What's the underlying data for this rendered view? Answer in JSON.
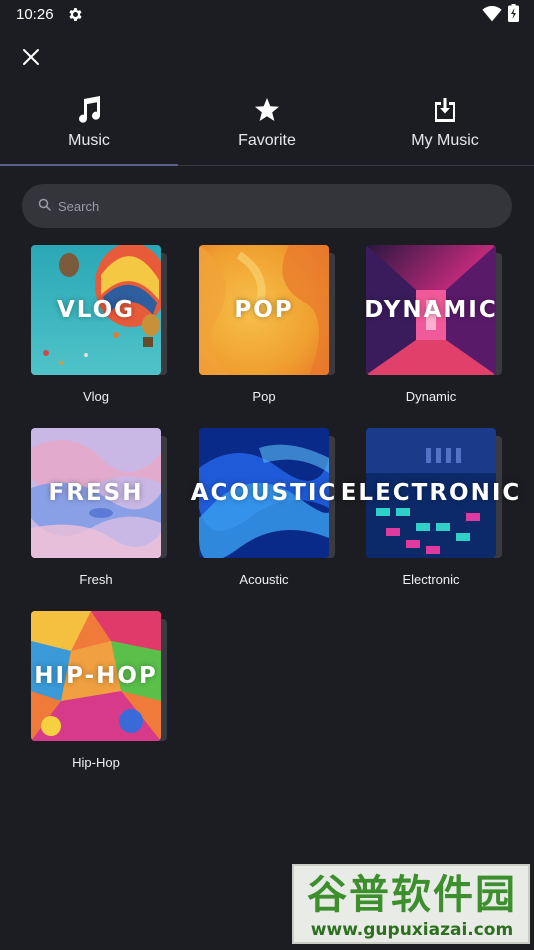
{
  "status_bar": {
    "time": "10:26",
    "icons": [
      "gear-icon",
      "wifi-icon",
      "battery-icon"
    ]
  },
  "header": {
    "close_icon": "close-icon"
  },
  "tabs": [
    {
      "label": "Music",
      "icon": "music-note-icon",
      "selected": true
    },
    {
      "label": "Favorite",
      "icon": "star-icon",
      "selected": false
    },
    {
      "label": "My Music",
      "icon": "download-icon",
      "selected": false
    }
  ],
  "search": {
    "placeholder": "Search",
    "value": ""
  },
  "genres": [
    {
      "title": "VLOG",
      "label": "Vlog"
    },
    {
      "title": "POP",
      "label": "Pop"
    },
    {
      "title": "DYNAMIC",
      "label": "Dynamic"
    },
    {
      "title": "FRESH",
      "label": "Fresh"
    },
    {
      "title": "ACOUSTIC",
      "label": "Acoustic"
    },
    {
      "title": "ELECTRONIC",
      "label": "Electronic"
    },
    {
      "title": "HIP-HOP",
      "label": "Hip-Hop"
    }
  ],
  "watermark": {
    "line1": "谷普软件园",
    "line2": "www.gupuxiazai.com"
  },
  "colors": {
    "background": "#1c1d22",
    "search_bg": "#34353b",
    "tab_indicator": "#5b5f87"
  }
}
